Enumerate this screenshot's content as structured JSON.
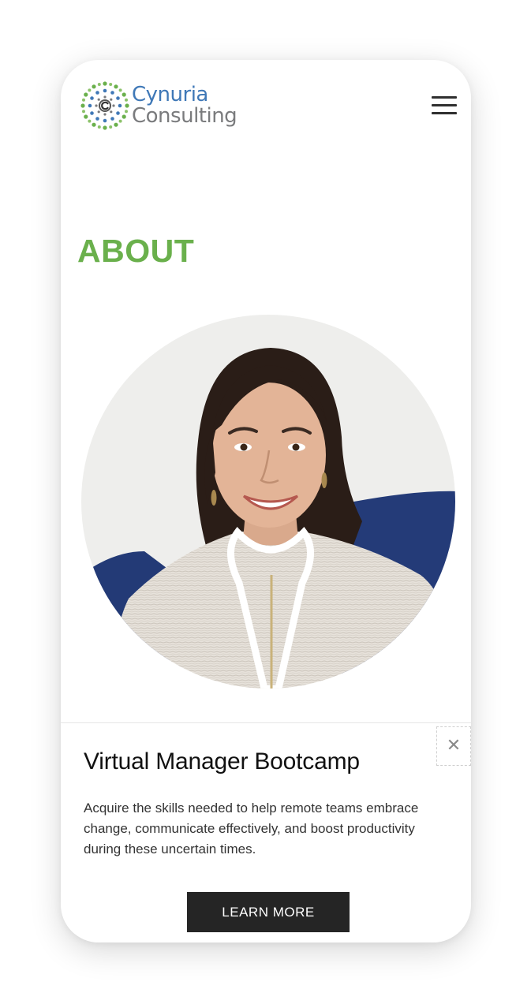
{
  "header": {
    "logo_line1": "Cynuria",
    "logo_line2": "Consulting",
    "logo_colors": {
      "blue": "#3f78b7",
      "green": "#6ab04c",
      "gray": "#7a7b7d"
    },
    "menu_icon": "hamburger-menu-icon"
  },
  "main": {
    "heading": "ABOUT",
    "heading_color": "#6ab04c"
  },
  "promo": {
    "title": "Virtual Manager Bootcamp",
    "body": "Acquire the skills needed to help remote teams embrace change, communicate effectively, and boost productivity during these uncertain times.",
    "button_label": "LEARN MORE",
    "close_glyph": "✕",
    "button_color": "#252525"
  }
}
